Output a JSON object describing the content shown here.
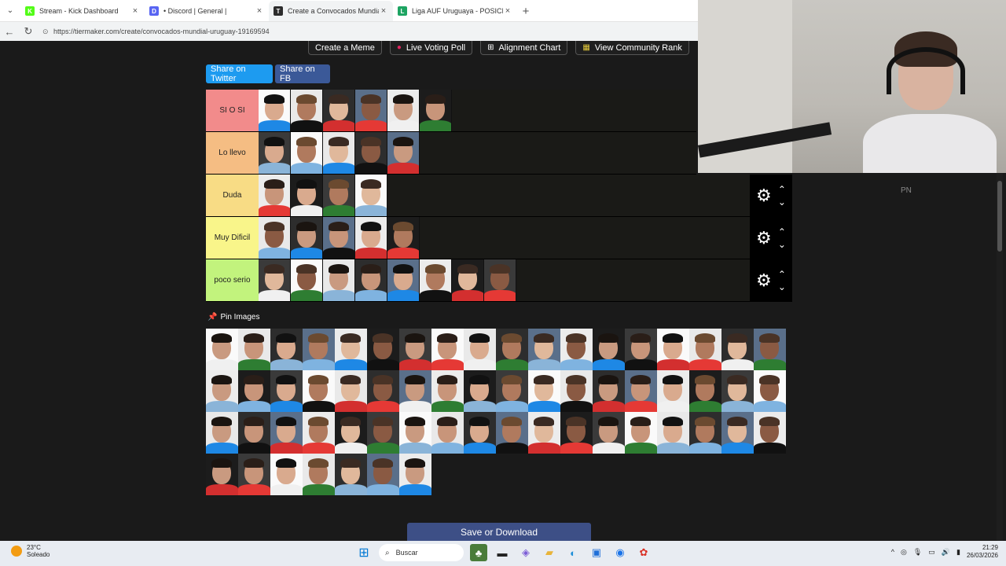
{
  "browser": {
    "tabs": [
      {
        "title": "Stream - Kick Dashboard",
        "fav_color": "#53fc18",
        "fav_text": "K"
      },
      {
        "title": "• Discord | General | ",
        "fav_color": "#5865f2",
        "fav_text": "D"
      },
      {
        "title": "Create a Convocados Mundial Uru",
        "fav_color": "#2c2c2c",
        "fav_text": "T"
      },
      {
        "title": "Liga AUF Uruguaya - POSICIONES",
        "fav_color": "#1da462",
        "fav_text": "L"
      }
    ],
    "url": "https://tiermaker.com/create/convocados-mundial-uruguay-19169594"
  },
  "toolbar": {
    "create_meme": "Create a Meme",
    "live_voting": "Live Voting Poll",
    "alignment_chart": "Alignment Chart",
    "community_rank": "View Community Rank"
  },
  "share": {
    "twitter": "Share on Twitter",
    "fb": "Share on FB"
  },
  "tiers": [
    {
      "label": "SI O SI",
      "color": "#f28b8b",
      "count": 6,
      "controls": false
    },
    {
      "label": "Lo llevo",
      "color": "#f5bd83",
      "count": 5,
      "controls": false
    },
    {
      "label": "Duda",
      "color": "#f8dc85",
      "count": 4,
      "controls": true
    },
    {
      "label": "Muy Dificil",
      "color": "#f9f58a",
      "count": 5,
      "controls": true
    },
    {
      "label": "poco serio",
      "color": "#c2f37d",
      "count": 8,
      "controls": true
    }
  ],
  "pin_images": "Pin Images",
  "pool_count": 61,
  "save_button": "Save or Download",
  "overlay_text": "PN",
  "taskbar": {
    "weather_temp": "23°C",
    "weather_desc": "Soleado",
    "search": "Buscar",
    "time": "21:29",
    "date": "26/03/2026"
  }
}
